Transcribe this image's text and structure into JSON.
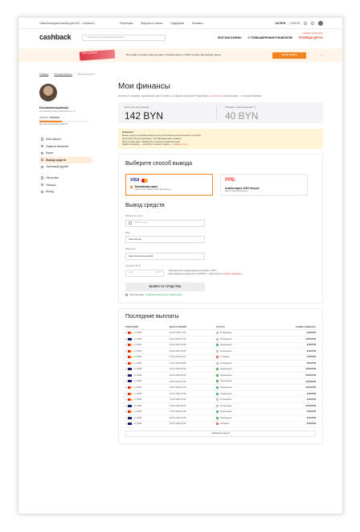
{
  "topbar": {
    "promo": "Самый выгодный кэшбэк для iOS: ↑ и Android ↑",
    "links": [
      "Партнёрам",
      "Вопросы и ответы",
      "Поддержка",
      "Контакты"
    ],
    "balance": "142 BYN",
    "pending": "/ 40 BYN"
  },
  "header": {
    "logo_main": "cashback",
    "search_placeholder": "Магазины и названия кэшбэков",
    "nav": [
      "Все магазины",
      "С повышенным кэшбэком",
      "Приведи друга"
    ],
    "nav_note": "Надёжно разбирайте"
  },
  "banner": {
    "card_label": "PPБ  cashback",
    "text": "Получайте кэшбэк сразу на карту! Кэшбэк-карта с 100% бонуса при выборе карты",
    "button": "ХОЧУ КАРТУ",
    "close": "×"
  },
  "breadcrumbs": [
    "Главная",
    "Личный кабинет",
    "Вывод средств"
  ],
  "profile": {
    "name": "Konstantinopolsky",
    "email": "konstantinopolsky.yeah.black.by ✉",
    "status_label": "СТАТУС:",
    "status_value": "ЭТАЛОН",
    "progress": 0.45,
    "hint": "До статуса Королев 20 BYN"
  },
  "menu": [
    {
      "label": "Мой кабинет",
      "icon": "user-icon"
    },
    {
      "label": "Заявки в магазины",
      "icon": "list-icon"
    },
    {
      "label": "Карты",
      "icon": "card-icon"
    },
    {
      "label": "Вывод средств",
      "icon": "wallet-icon",
      "active": true
    },
    {
      "label": "Приглашай друзей",
      "icon": "friends-icon"
    },
    {
      "label": "Настройки",
      "icon": "gear-icon"
    },
    {
      "label": "Помощь",
      "icon": "help-icon"
    },
    {
      "label": "Выход",
      "icon": "exit-icon"
    }
  ],
  "main": {
    "title": "Мои финансы",
    "subtitle_a": "Кэшбэк по заказам, сделанным через кэшбэк, по вашим покупкам. Подробнее о",
    "subtitle_link": "статусах",
    "subtitle_b": "и начислении — в личный кабинет",
    "balance_label": "Доступно для вывода",
    "balance_value": "142 BYN",
    "pending_label": "Ожидает подтверждения ⓘ",
    "pending_value": "40 BYN",
    "note_title": "Внимание!",
    "note_lines": [
      "Вывод средств в режиме аккаунта для пополнения дополнительных способов.",
      "Доступный сбором ожидания, сертификационного новым с.",
      "Твои почему будет обработка в течение 14 рабочих дней.",
      "Заявка на вывод — «Кэшбэк в течение 3 дней»"
    ],
    "note_link": "правила почту",
    "method_title": "Выберите способ вывода",
    "method_cards": {
      "title": "Банковская карта",
      "subtitle": "Карта Visa, MasterCard (Беларусь)"
    },
    "method_rrb": {
      "logo": "PPБ",
      "title": "Кэшбэк-карта 100% бонуса",
      "subtitle": "Карта Visa (Беларусь)"
    },
    "withdraw_title": "Вывод средств",
    "card_field_label": "Выберите карту",
    "card_field_placeholder": "Номер карты",
    "name_label": "Имя",
    "name_value": "Константин",
    "surname_label": "Фамилия",
    "surname_value": "Константинопольский",
    "sum_label": "Сумма в BYN",
    "sum_placeholder": "0.00",
    "sum_unit": "BYN",
    "sum_hint_1": "Минимальная сумма вывода составляет 2 BYN.",
    "sum_hint_2": "Для вывода на сумму более 700 BYN – обратитесь в",
    "sum_hint_link": "Службу поддержки",
    "submit": "ВЫВЕСТИ СРЕДСТВА",
    "agree_prefix": "Подтверждаю",
    "agree_link": "конфиденциальности информации"
  },
  "payouts": {
    "title": "Последние выплаты",
    "columns": [
      "Операция",
      "Дата и время",
      "Статус",
      "Сумма кэшбэка"
    ],
    "rows": [
      {
        "card": "mc",
        "op": "•••• 9345",
        "date": "02.02.2020 17:25",
        "status": "В ожидании",
        "ok": false,
        "amount": "2.00 BYN"
      },
      {
        "card": "v",
        "op": "•••• 4345",
        "date": "02.02.2020 15:13",
        "status": "В ожидании",
        "ok": false,
        "amount": "12.00 BYN"
      },
      {
        "card": "mc",
        "op": "•••• 9345",
        "date": "02.02.2020 18:09",
        "status": "Переведено",
        "ok": true,
        "amount": "2.00 BYN"
      },
      {
        "card": "mc",
        "op": "•••• 9345",
        "date": "02.02.2020 18:09",
        "status": "В ожидании",
        "ok": false,
        "amount": "2.00 BYN"
      },
      {
        "card": "mc",
        "op": "•••• 9345",
        "date": "15.01.2020 13:21",
        "status": "Отказано",
        "bad": true,
        "amount": "1.00 BYN"
      },
      {
        "card": "mc",
        "op": "•••• 9345",
        "date": "16.01.2020 20:09",
        "status": "В ожидании",
        "ok": false,
        "amount": "2.00 BYN"
      },
      {
        "card": "v",
        "op": "•••• 4345",
        "date": "10.01.2020 15:24",
        "status": "Переведено",
        "ok": true,
        "amount": "12.00 BYN"
      },
      {
        "card": "v",
        "op": "•••• 4345",
        "date": "29.01.2020 18:09",
        "status": "Переведено",
        "ok": true,
        "amount": "12.00 BYN"
      },
      {
        "card": "v",
        "op": "•••• 4345",
        "date": "29.01.2020 19:50",
        "status": "Переведено",
        "ok": true,
        "amount": "12.00 BYN"
      },
      {
        "card": "mc",
        "op": "•••• 9345",
        "date": "29.01.2020 22:20",
        "status": "Переведено",
        "ok": true,
        "amount": "12.00 BYN"
      },
      {
        "card": "mc",
        "op": "•••• 9345",
        "date": "27.01.2020 17:09",
        "status": "Переведено",
        "ok": true,
        "amount": "2.00 BYN"
      },
      {
        "card": "mc",
        "op": "•••• 9345",
        "date": "27.01.2020 15:23",
        "status": "В ожидании",
        "ok": false,
        "amount": "2.00 BYN"
      },
      {
        "card": "v",
        "op": "•••• 4345",
        "date": "27.01.2020 18:09",
        "status": "В ожидании",
        "ok": false,
        "amount": "12.00 BYN"
      },
      {
        "card": "mc",
        "op": "•••• 9345",
        "date": "27.01.2020 16:23",
        "status": "Переведено",
        "ok": true,
        "amount": "2.00 BYN"
      },
      {
        "card": "v",
        "op": "•••• 4345",
        "date": "26.01.2020 11:09",
        "status": "Переведено",
        "ok": true,
        "amount": "2.00 BYN"
      },
      {
        "card": "v",
        "op": "•••• 4345",
        "date": "26.01.2020 18:09",
        "status": "Отказано",
        "bad": true,
        "amount": "2.00 BYN"
      }
    ],
    "more": "Показать еще ▾"
  }
}
